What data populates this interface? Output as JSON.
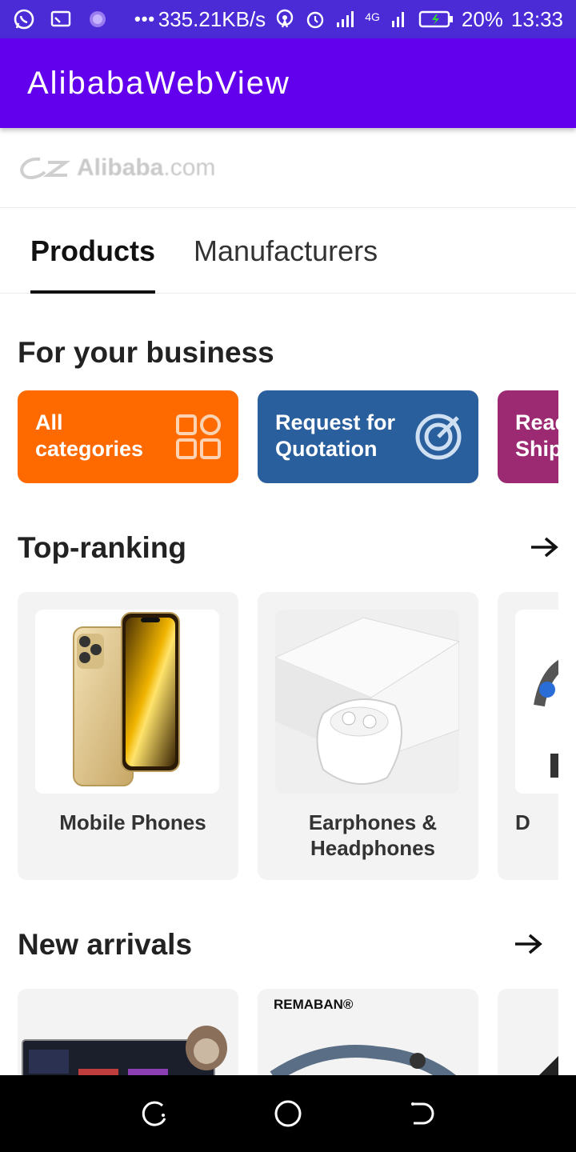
{
  "status_bar": {
    "speed": "335.21KB/s",
    "network": "4G",
    "battery": "20%",
    "time": "13:33"
  },
  "app_bar": {
    "title": "AlibabaWebView"
  },
  "logo": {
    "brand": "Alibaba",
    "domain": ".com"
  },
  "tabs": [
    {
      "label": "Products",
      "active": true
    },
    {
      "label": "Manufacturers",
      "active": false
    }
  ],
  "business": {
    "title": "For your business",
    "cards": [
      {
        "label": "All categories",
        "color": "#ff6a00",
        "icon": "grid-icon"
      },
      {
        "label": "Request for Quotation",
        "color": "#2a5f9e",
        "icon": "target-icon"
      },
      {
        "label": "Ready to Ship",
        "color": "#9c2a72",
        "icon": "ship-icon"
      }
    ]
  },
  "top_ranking": {
    "title": "Top-ranking",
    "items": [
      {
        "label": "Mobile Phones"
      },
      {
        "label": "Earphones & Headphones"
      },
      {
        "label": "D"
      }
    ]
  },
  "new_arrivals": {
    "title": "New arrivals",
    "items": [
      {
        "label": "",
        "badge": ""
      },
      {
        "label": "",
        "badge": "REMABAN®"
      },
      {
        "label": "",
        "badge": ""
      }
    ]
  }
}
